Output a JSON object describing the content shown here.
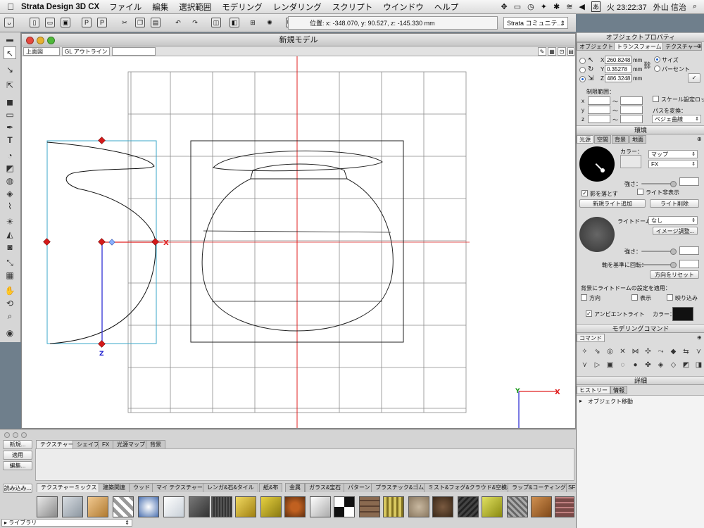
{
  "menubar": {
    "app_name": "Strata Design 3D CX",
    "items": [
      "ファイル",
      "編集",
      "選択範囲",
      "モデリング",
      "レンダリング",
      "スクリプト",
      "ウインドウ",
      "ヘルプ"
    ],
    "clock": "火 23:22:37",
    "user": "外山 信治"
  },
  "toolbar": {
    "coordinates": "位置: x: -348.070, y: 90.527, z: -145.330 mm",
    "community_select": "Strata コミュニテ..."
  },
  "model_window": {
    "title": "新規モデル",
    "view_select": "上面図",
    "render_mode_select": "GL アウトライン"
  },
  "axis_labels": {
    "x": "X",
    "y": "Y",
    "z": "Z"
  },
  "bottom_panel": {
    "buttons": {
      "new": "新規...",
      "apply": "適用",
      "edit": "編集...",
      "load": "読み込み..."
    },
    "tabs": [
      "テクスチャー",
      "シェイプ",
      "FX",
      "光源マップ",
      "背景"
    ],
    "library_tabs": [
      "テクスチャーミックス",
      "建築関連",
      "ウッド",
      "マイ テクスチャー",
      "レンガ&石&タイル",
      "紙&布",
      "金属",
      "ガラス&宝石",
      "パターン",
      "プラスチック&ゴム",
      "ミスト&フォグ&クラウド&空模様",
      "ラップ&コーティング",
      "SF"
    ],
    "library_label": "ライブラリ"
  },
  "object_properties": {
    "title": "オブジェクトプロパティ",
    "tabs": [
      "オブジェクト",
      "トランスフォーム",
      "テクスチャー"
    ],
    "x_value": "260.8248",
    "y_value": "0.35278",
    "z_value": "486.3248",
    "unit": "mm",
    "size_label": "サイズ",
    "percent_label": "パーセント",
    "limit_label": "制限範囲：",
    "limit_axes": [
      "x",
      "y",
      "z"
    ],
    "tilde": "〜",
    "scale_lock_label": "スケール設定ロック",
    "path_convert_label": "パスを変換：",
    "path_select": "ベジェ曲線"
  },
  "environment": {
    "title": "環境",
    "tabs": [
      "光源",
      "空間",
      "背景",
      "地面"
    ],
    "color_label": "カラー：",
    "map_select": "マップ",
    "fx_select": "FX",
    "strength_label": "強さ：",
    "cast_shadow_label": "影を落とす",
    "hide_light_label": "ライト非表示",
    "new_light_button": "新規ライト追加",
    "delete_light_button": "ライト削除",
    "light_dome_label": "ライトドーム：",
    "light_dome_select": "なし",
    "image_adjust_button": "イメージ調整...",
    "strength2_label": "強さ：",
    "rotate_axis_label": "軸を基準に回転：",
    "reset_direction_button": "方向をリセット",
    "apply_dome_label": "背景にライトドームの設定を適用：",
    "direction_label": "方向",
    "display_label": "表示",
    "crop_label": "映り込み",
    "ambient_label": "アンビエントライト",
    "ambient_color_label": "カラー："
  },
  "modeling_commands": {
    "title": "モデリングコマンド",
    "tab": "コマンド"
  },
  "details": {
    "title": "詳細",
    "tabs": [
      "ヒストリー",
      "情報"
    ],
    "history_item": "オブジェクト移動"
  },
  "colors": {
    "axis_x": "#e02020",
    "axis_y": "#1a9a1a",
    "axis_z": "#2020d0",
    "selection": "#3aa7c8",
    "handle": "#d41a1a"
  }
}
